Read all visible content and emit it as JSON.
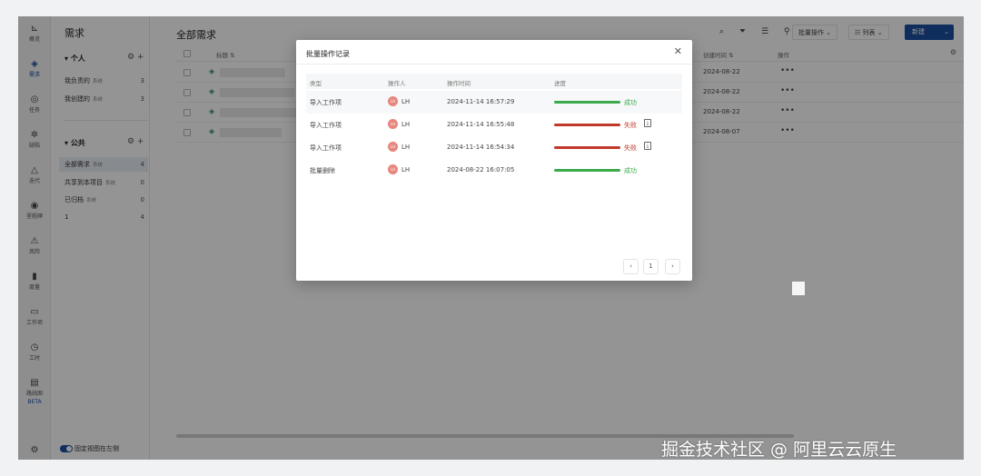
{
  "rail": {
    "items": [
      {
        "icon": "chart-line-icon",
        "glyph": "⊾",
        "label": "概览"
      },
      {
        "icon": "stack-icon",
        "glyph": "◈",
        "label": "需求"
      },
      {
        "icon": "shield-icon",
        "glyph": "◎",
        "label": "任务"
      },
      {
        "icon": "bug-icon",
        "glyph": "✲",
        "label": "缺陷"
      },
      {
        "icon": "iteration-icon",
        "glyph": "△",
        "label": "迭代"
      },
      {
        "icon": "milestone-icon",
        "glyph": "◉",
        "label": "里程碑"
      },
      {
        "icon": "risk-icon",
        "glyph": "⚠",
        "label": "风险"
      },
      {
        "icon": "metrics-icon",
        "glyph": "▮",
        "label": "度量"
      },
      {
        "icon": "workitem-icon",
        "glyph": "▭",
        "label": "工作项"
      },
      {
        "icon": "timer-icon",
        "glyph": "◷",
        "label": "工时"
      },
      {
        "icon": "roadmap-icon",
        "glyph": "▤",
        "label": "路线图"
      }
    ],
    "beta": "BETA",
    "settings_glyph": "⚙"
  },
  "sidebar": {
    "title": "需求",
    "personal": {
      "label": "个人",
      "tools": "⚙ +",
      "items": [
        {
          "label": "我负责的",
          "tag": "系统",
          "count": "3"
        },
        {
          "label": "我创建的",
          "tag": "系统",
          "count": "3"
        }
      ]
    },
    "public": {
      "label": "公共",
      "tools": "⚙ +",
      "items": [
        {
          "label": "全部需求",
          "tag": "系统",
          "count": "4"
        },
        {
          "label": "共享到本项目",
          "tag": "系统",
          "count": "0"
        },
        {
          "label": "已归档",
          "tag": "系统",
          "count": "0"
        },
        {
          "label": "1",
          "tag": "",
          "count": "4"
        }
      ]
    },
    "pin_label": "固定视图在左侧"
  },
  "main": {
    "title": "全部需求",
    "tool_icons": "⌕ ⏷ ☰ ⚲",
    "batch_label": "批量操作 ⌄",
    "list_label": "☷ 列表 ⌄",
    "new_label": "新建",
    "new_arrow": "⌄",
    "columns": {
      "title": "标题 ⇅",
      "date": "创建时间 ⇅",
      "op": "操作",
      "settings": "⚙"
    },
    "rows": [
      {
        "date": "2024-08-22",
        "more": "•••"
      },
      {
        "date": "2024-08-22",
        "more": "•••"
      },
      {
        "date": "2024-08-22",
        "more": "•••"
      },
      {
        "date": "2024-08-07",
        "more": "•••"
      }
    ]
  },
  "modal": {
    "title": "批量操作记录",
    "close": "✕",
    "headers": {
      "type": "类型",
      "operator": "操作人",
      "time": "操作时间",
      "progress": "进度"
    },
    "rows": [
      {
        "type": "导入工作项",
        "avatar": "LH",
        "user": "LH",
        "time": "2024-11-14 16:57:29",
        "status": "成功",
        "progress": 1.0,
        "color": "#3aaa4a",
        "download": false
      },
      {
        "type": "导入工作项",
        "avatar": "LH",
        "user": "LH",
        "time": "2024-11-14 16:55:48",
        "status": "失败",
        "progress": 1.0,
        "color": "#c0392b",
        "download": true
      },
      {
        "type": "导入工作项",
        "avatar": "LH",
        "user": "LH",
        "time": "2024-11-14 16:54:34",
        "status": "失败",
        "progress": 1.0,
        "color": "#c0392b",
        "download": true
      },
      {
        "type": "批量删除",
        "avatar": "LH",
        "user": "LH",
        "time": "2024-08-22 16:07:05",
        "status": "成功",
        "progress": 1.0,
        "color": "#3aaa4a",
        "download": false
      }
    ],
    "pager": {
      "prev": "‹",
      "page": "1",
      "next": "›"
    },
    "download_glyph": "⤓"
  },
  "watermark": "掘金技术社区 @ 阿里云云原生"
}
